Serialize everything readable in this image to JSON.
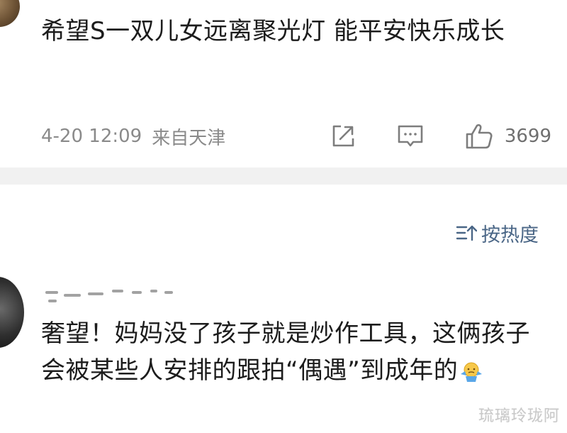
{
  "post": {
    "text": "希望S一双儿女远离聚光灯 能平安快乐成长",
    "time": "4-20 12:09",
    "source": "来自天津",
    "like_count": "3699",
    "share_icon": "share-icon",
    "comment_icon": "comment-icon",
    "like_icon": "thumbs-up-icon"
  },
  "sort": {
    "label": "按热度",
    "icon": "sort-icon"
  },
  "comment": {
    "text": "奢望！妈妈没了孩子就是炒作工具，这俩孩子会被某些人安排的跟拍“偶遇”到成年的",
    "emoji": "shrug-emoji-icon"
  },
  "watermark": "琉璃玲珑阿",
  "colors": {
    "background": "#ffffff",
    "divider": "#f1f1f1",
    "meta_text": "#8a8a8a",
    "sort_accent": "#4a6686"
  }
}
